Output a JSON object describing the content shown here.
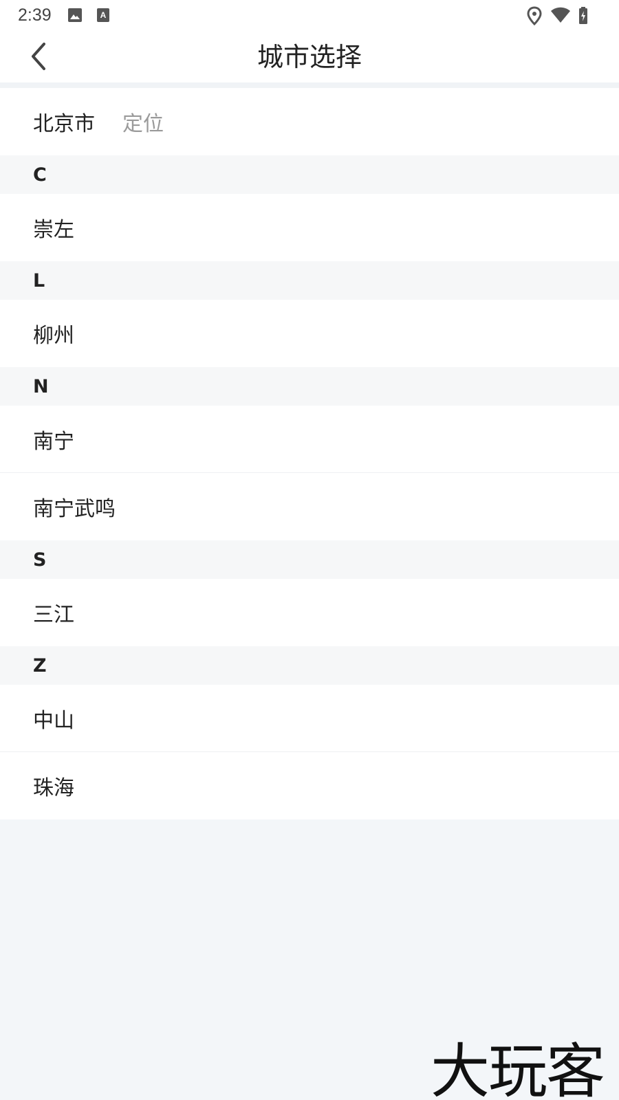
{
  "status_bar": {
    "time": "2:39",
    "left_icons": [
      "image-icon",
      "accessibility-a-icon"
    ],
    "right_icons": [
      "location-pin-icon",
      "wifi-icon",
      "battery-icon"
    ]
  },
  "header": {
    "back_icon": "chevron-left-icon",
    "title": "城市选择"
  },
  "location": {
    "city": "北京市",
    "tag": "定位"
  },
  "sections": [
    {
      "letter": "C",
      "cities": [
        "崇左"
      ]
    },
    {
      "letter": "L",
      "cities": [
        "柳州"
      ]
    },
    {
      "letter": "N",
      "cities": [
        "南宁",
        "南宁武鸣"
      ]
    },
    {
      "letter": "S",
      "cities": [
        "三江"
      ]
    },
    {
      "letter": "Z",
      "cities": [
        "中山",
        "珠海"
      ]
    }
  ],
  "watermark": "大玩客",
  "colors": {
    "page_background": "#f3f6f9",
    "row_background": "#ffffff",
    "section_background": "#f6f7f8",
    "secondary_text": "#9a9a9a"
  }
}
